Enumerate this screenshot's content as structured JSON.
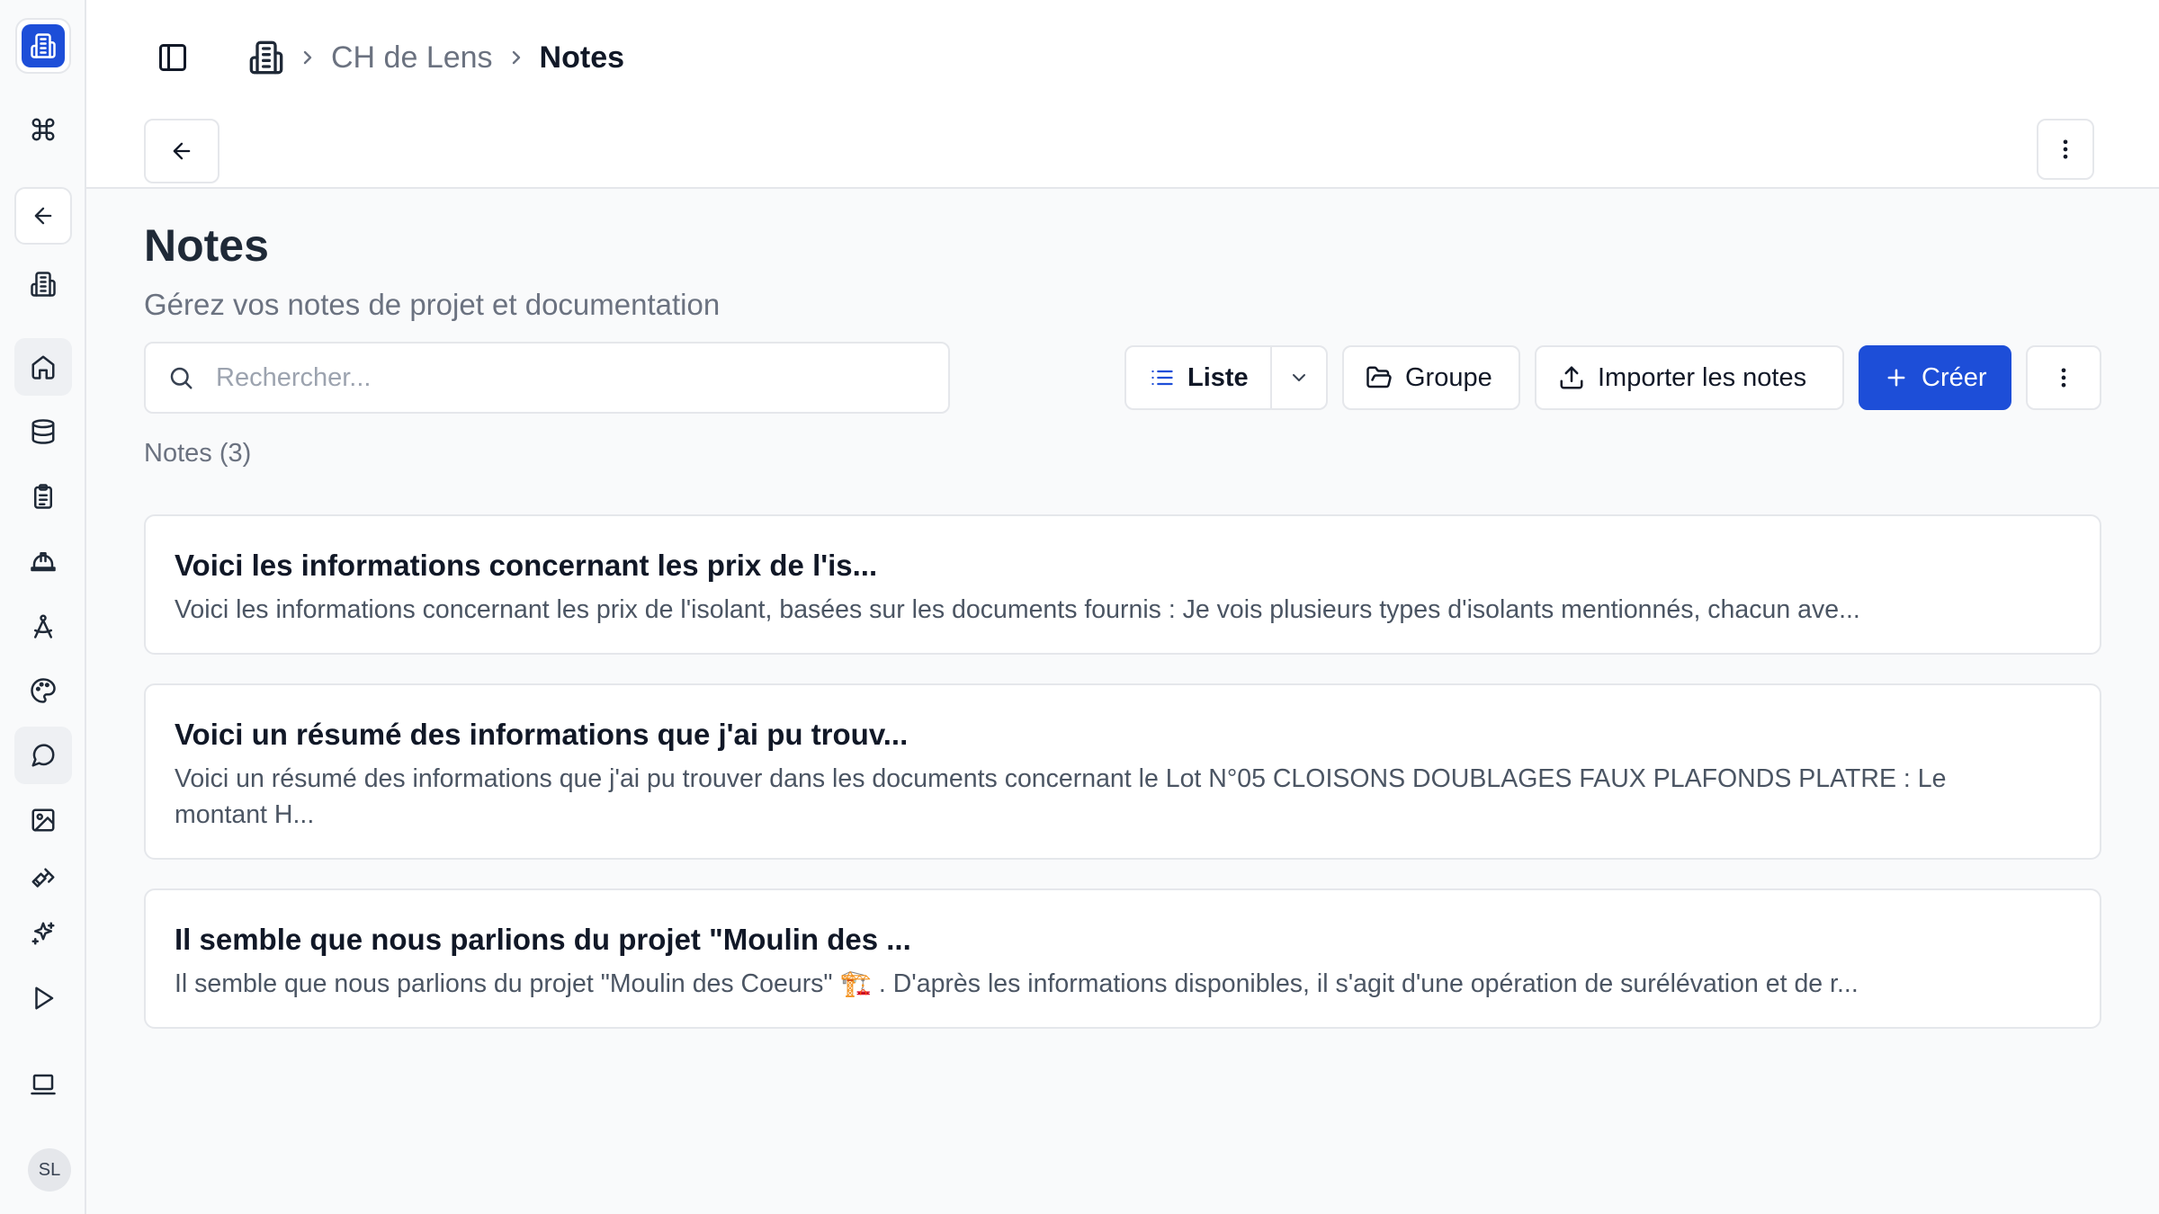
{
  "breadcrumb": {
    "project": "CH de Lens",
    "current": "Notes"
  },
  "page": {
    "title": "Notes",
    "subtitle": "Gérez vos notes de projet et documentation"
  },
  "search": {
    "placeholder": "Rechercher...",
    "value": ""
  },
  "toolbar": {
    "view_label": "Liste",
    "group_label": "Groupe",
    "import_label": "Importer les notes",
    "create_label": "Créer"
  },
  "notes_count": "Notes (3)",
  "notes": [
    {
      "title": "Voici les informations concernant les prix de l'is...",
      "preview": "Voici les informations concernant les prix de l'isolant, basées sur les documents fournis : Je vois plusieurs types d'isolants mentionnés, chacun ave..."
    },
    {
      "title": "Voici un résumé des informations que j'ai pu trouv...",
      "preview": "Voici un résumé des informations que j'ai pu trouver dans les documents concernant le Lot N°05 CLOISONS DOUBLAGES FAUX PLAFONDS PLATRE : Le montant H..."
    },
    {
      "title": "Il semble que nous parlions du projet \"Moulin des ...",
      "preview": "Il semble que nous parlions du projet \"Moulin des Coeurs\" 🏗️ . D'après les informations disponibles, il s'agit d'une opération de surélévation et de r..."
    }
  ],
  "user": {
    "initials": "SL"
  },
  "colors": {
    "accent": "#1d4ed8",
    "border": "#e5e7eb",
    "muted_text": "#6b7280"
  },
  "icons": {
    "sidebar": [
      "building-logo-icon",
      "command-icon",
      "arrow-left-icon",
      "building-icon",
      "home-icon",
      "database-icon",
      "clipboard-icon",
      "hard-hat-icon",
      "compass-icon",
      "palette-icon",
      "chat-icon",
      "image-icon",
      "ruler-pencil-icon",
      "sparkles-icon",
      "play-icon",
      "laptop-icon"
    ]
  }
}
